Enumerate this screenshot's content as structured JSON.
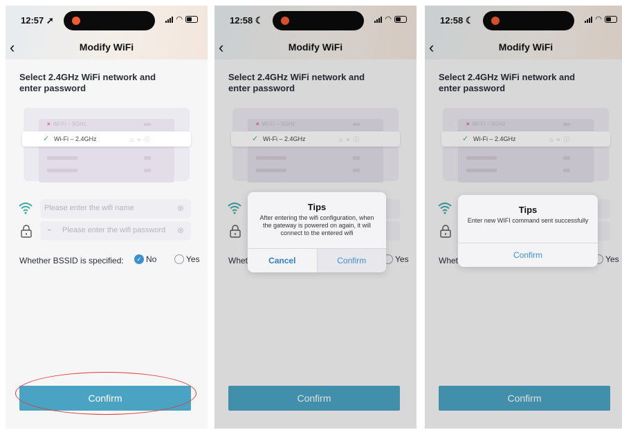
{
  "screens": [
    {
      "time": "12:57",
      "time_icon": "location-arrow-icon",
      "title": "Modify WiFi",
      "heading": "Select 2.4GHz WiFi network and enter password",
      "illustration": {
        "wifi5": "Wi-Fi – 5GHz",
        "wifi24": "Wi-Fi – 2.4GHz"
      },
      "wifi_name_placeholder": "Please enter the wifi name",
      "wifi_password_placeholder": "Please enter the wifi password",
      "bssid_label": "Whether BSSID is specified:",
      "bssid_no": "No",
      "bssid_yes": "Yes",
      "confirm": "Confirm"
    },
    {
      "time": "12:58",
      "time_icon": "moon-icon",
      "title": "Modify WiFi",
      "heading": "Select 2.4GHz WiFi network and enter password",
      "illustration": {
        "wifi5": "Wi-Fi – 5GHz",
        "wifi24": "Wi-Fi – 2.4GHz"
      },
      "bssid_label": "Whet",
      "bssid_yes": "Yes",
      "confirm": "Confirm",
      "dialog": {
        "title": "Tips",
        "message": "After entering the wifi configuration, when the gateway is powered on again, it will connect to the entered wifi",
        "cancel": "Cancel",
        "confirm": "Confirm"
      }
    },
    {
      "time": "12:58",
      "time_icon": "moon-icon",
      "title": "Modify WiFi",
      "heading": "Select 2.4GHz WiFi network and enter password",
      "illustration": {
        "wifi5": "Wi-Fi – 5GHz",
        "wifi24": "Wi-Fi – 2.4GHz"
      },
      "bssid_label": "Whet",
      "bssid_yes": "Yes",
      "confirm": "Confirm",
      "dialog": {
        "title": "Tips",
        "message": "Enter new WIFI command sent successfully",
        "confirm": "Confirm"
      }
    }
  ],
  "colors": {
    "accent_button": "#4ba3c3",
    "dialog_link": "#3a8fd0",
    "annotation_circle": "#d93b3b",
    "wifi_icon": "#3aa8a0"
  }
}
